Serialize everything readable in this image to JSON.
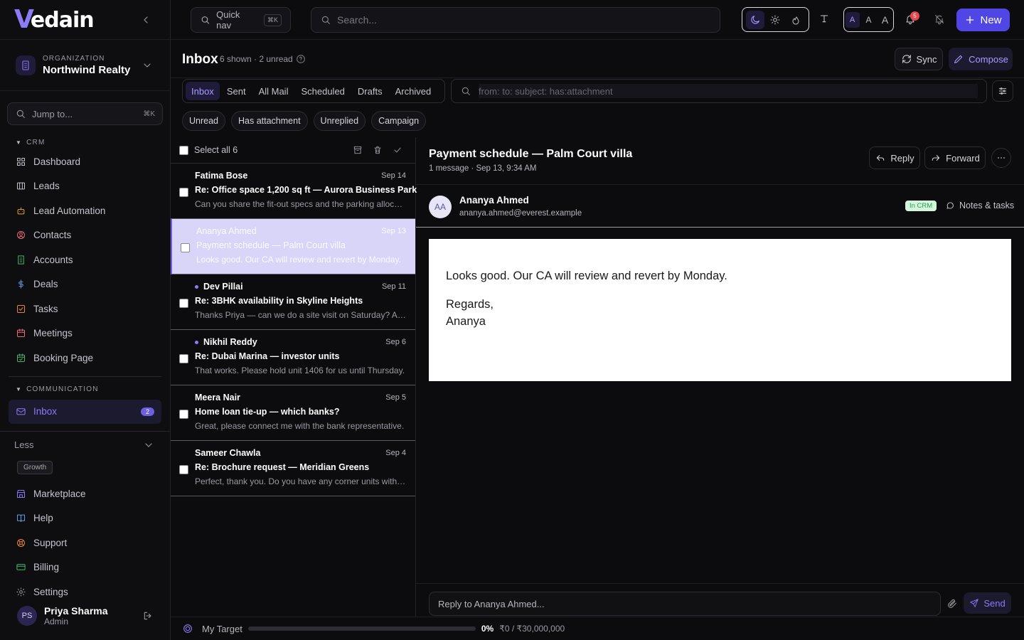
{
  "app": {
    "logo_mark": "V",
    "logo_text": "edain"
  },
  "organization": {
    "label": "ORGANIZATION",
    "name": "Northwind Realty"
  },
  "jump": {
    "placeholder": "Jump to...",
    "shortcut": "⌘K"
  },
  "sidebar": {
    "crm_header": "CRM",
    "crm_items": [
      {
        "label": "Dashboard",
        "icon": "grid-icon"
      },
      {
        "label": "Leads",
        "icon": "columns-icon"
      },
      {
        "label": "Lead Automation",
        "icon": "bot-icon"
      },
      {
        "label": "Contacts",
        "icon": "contact-icon"
      },
      {
        "label": "Accounts",
        "icon": "building-icon"
      },
      {
        "label": "Deals",
        "icon": "dollar-icon"
      },
      {
        "label": "Tasks",
        "icon": "task-icon"
      },
      {
        "label": "Meetings",
        "icon": "calendar-icon"
      },
      {
        "label": "Booking Page",
        "icon": "calendar-check-icon"
      }
    ],
    "comm_header": "COMMUNICATION",
    "inbox_label": "Inbox",
    "inbox_badge": "2",
    "less_label": "Less",
    "growth_tag": "Growth",
    "bottom_items": [
      {
        "label": "Marketplace",
        "icon": "store-icon"
      },
      {
        "label": "Help",
        "icon": "book-icon"
      },
      {
        "label": "Support",
        "icon": "lifebuoy-icon"
      },
      {
        "label": "Billing",
        "icon": "card-icon"
      },
      {
        "label": "Settings",
        "icon": "gear-icon"
      }
    ]
  },
  "user": {
    "initials": "PS",
    "name": "Priya Sharma",
    "role": "Admin"
  },
  "topbar": {
    "quick_nav_label": "Quick nav",
    "quick_nav_shortcut": "⌘K",
    "search_placeholder": "Search...",
    "font_sizes": [
      "A",
      "A",
      "A"
    ],
    "notification_count": "5",
    "new_label": "New"
  },
  "page": {
    "title": "Inbox",
    "meta": "6 shown · 2 unread",
    "sync_label": "Sync",
    "compose_label": "Compose"
  },
  "tabs": [
    "Inbox",
    "Sent",
    "All Mail",
    "Scheduled",
    "Drafts",
    "Archived"
  ],
  "filter": {
    "placeholder": "from: to: subject: has:attachment"
  },
  "chips": [
    "Unread",
    "Has attachment",
    "Unreplied",
    "Campaign"
  ],
  "list": {
    "select_all_label": "Select all 6",
    "messages": [
      {
        "from": "Fatima Bose",
        "date": "Sep 14",
        "subject": "Re: Office space 1,200 sq ft — Aurora Business Park",
        "preview": "Can you share the fit-out specs and the parking allocation?",
        "unread": false
      },
      {
        "from": "Ananya Ahmed",
        "date": "Sep 13",
        "subject": "Payment schedule — Palm Court villa",
        "preview": "Looks good. Our CA will review and revert by Monday.",
        "unread": false
      },
      {
        "from": "Dev Pillai",
        "date": "Sep 11",
        "subject": "Re: 3BHK availability in Skyline Heights",
        "preview": "Thanks Priya — can we do a site visit on Saturday? Also wh...",
        "unread": true
      },
      {
        "from": "Nikhil Reddy",
        "date": "Sep 6",
        "subject": "Re: Dubai Marina — investor units",
        "preview": "That works. Please hold unit 1406 for us until Thursday.",
        "unread": true
      },
      {
        "from": "Meera Nair",
        "date": "Sep 5",
        "subject": "Home loan tie-up — which banks?",
        "preview": "Great, please connect me with the bank representative.",
        "unread": false
      },
      {
        "from": "Sameer Chawla",
        "date": "Sep 4",
        "subject": "Re: Brochure request — Meridian Greens",
        "preview": "Perfect, thank you. Do you have any corner units with a pa...",
        "unread": false
      }
    ]
  },
  "reader": {
    "subject": "Payment schedule — Palm Court villa",
    "meta": "1 message · Sep 13, 9:34 AM",
    "reply_label": "Reply",
    "forward_label": "Forward",
    "sender_initials": "AA",
    "sender_name": "Ananya Ahmed",
    "sender_email": "ananya.ahmed@everest.example",
    "crm_badge": "In CRM",
    "notes_label": "Notes & tasks",
    "body": {
      "line1": "Looks good. Our CA will review and revert by Monday.",
      "line2": "Regards,",
      "line3": "Ananya"
    },
    "reply_placeholder": "Reply to Ananya Ahmed...",
    "send_label": "Send"
  },
  "target": {
    "label": "My Target",
    "progress_percent": 0,
    "percent_text": "0%",
    "amount_text": "₹0 / ₹30,000,000"
  },
  "colors": {
    "accent": "#8b7cf6",
    "primary": "#4f46e5",
    "background": "#0c0c0e"
  }
}
